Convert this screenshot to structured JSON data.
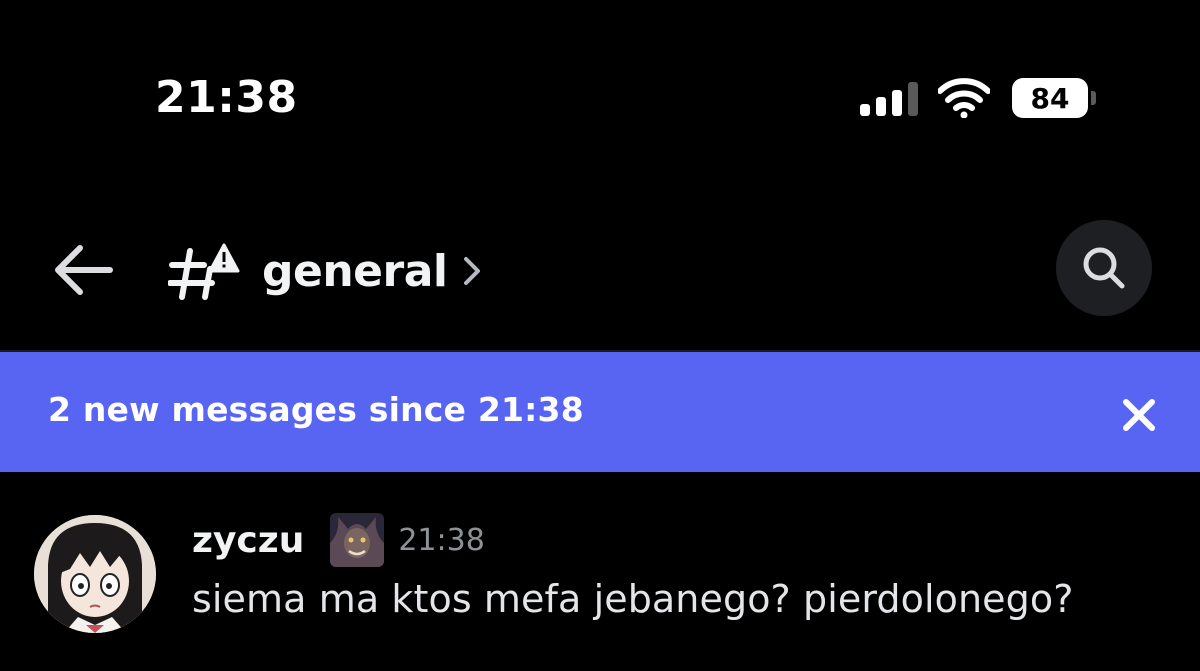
{
  "status_bar": {
    "time": "21:38",
    "battery_level": "84",
    "signal_bars_active": 3,
    "signal_bars_total": 4,
    "icons": [
      "signal-icon",
      "wifi-icon",
      "battery-icon"
    ]
  },
  "header": {
    "back_icon": "back-arrow-icon",
    "channel_icon": "text-channel-locked-icon",
    "channel_name": "general",
    "chevron_icon": "chevron-right-icon",
    "search_icon": "search-icon"
  },
  "banner": {
    "text": "2 new messages since 21:38",
    "close_icon": "close-icon",
    "color": "#5865f2"
  },
  "messages": [
    {
      "username": "zyczu",
      "timestamp": "21:38",
      "content": "siema ma ktos mefa jebanego? pierdolonego?",
      "avatar": "anime-girl-avatar",
      "role_icon": "warrior-role-icon"
    }
  ],
  "colors": {
    "background": "#000000",
    "accent": "#5865f2",
    "search_button_bg": "#1e1f22",
    "timestamp": "#8e9297"
  }
}
